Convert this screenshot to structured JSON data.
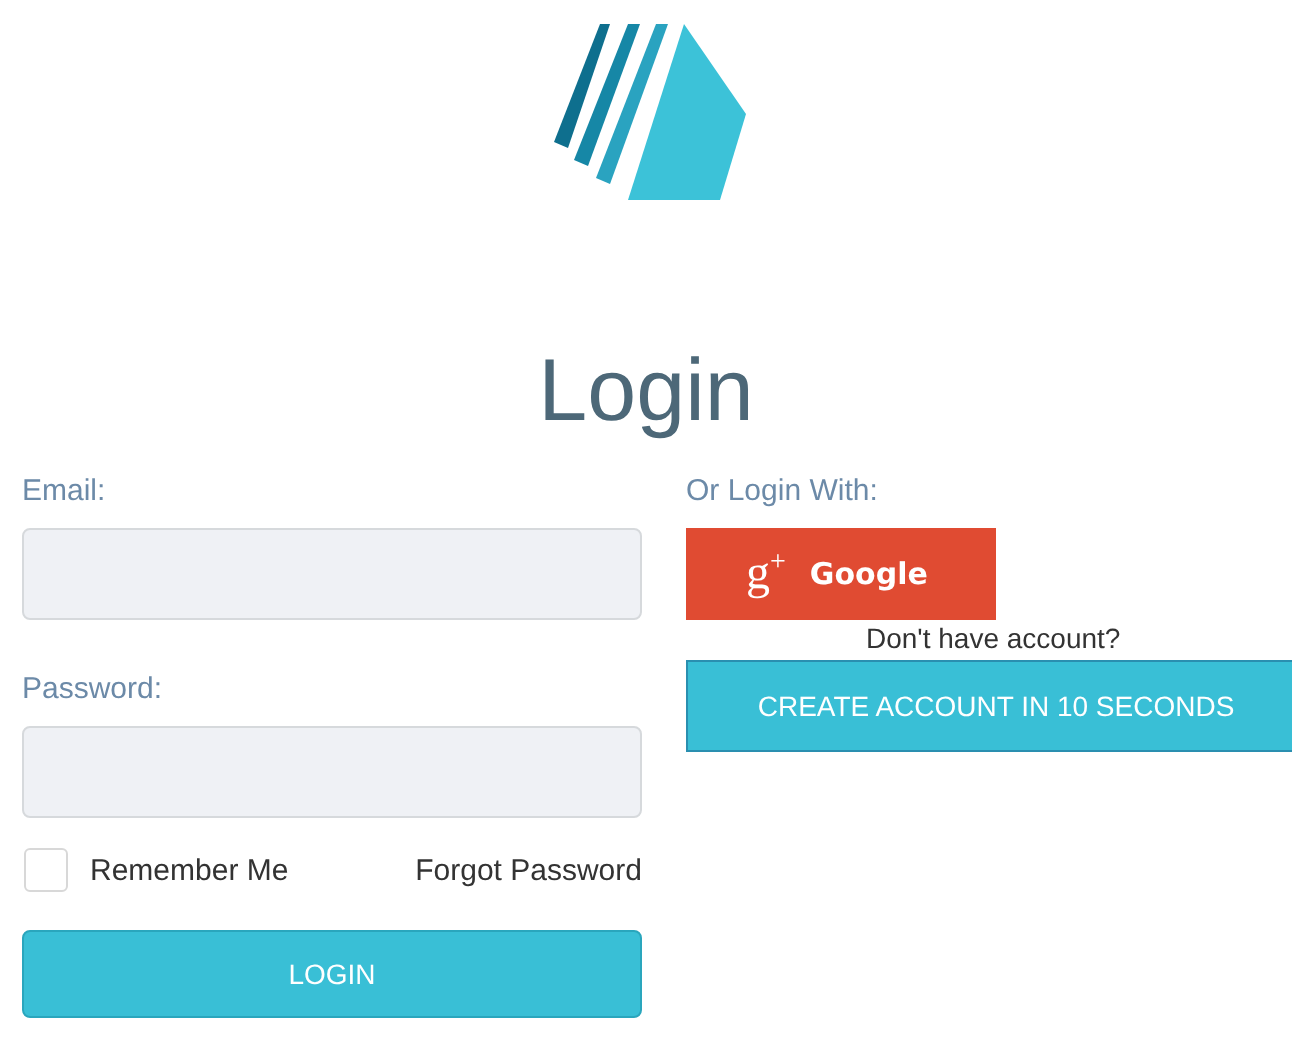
{
  "title": "Login",
  "form": {
    "email_label": "Email:",
    "password_label": "Password:",
    "remember": {
      "label": "Remember Me",
      "checked": false
    },
    "forgot_link": "Forgot Password",
    "submit": "LOGIN"
  },
  "social": {
    "heading": "Or Login With:",
    "google_icon": "g$^{+}$",
    "google_label": "Google",
    "signup_prompt": "Don't have account?",
    "create_button": "CREATE ACCOUNT IN 10 SECONDS"
  }
}
